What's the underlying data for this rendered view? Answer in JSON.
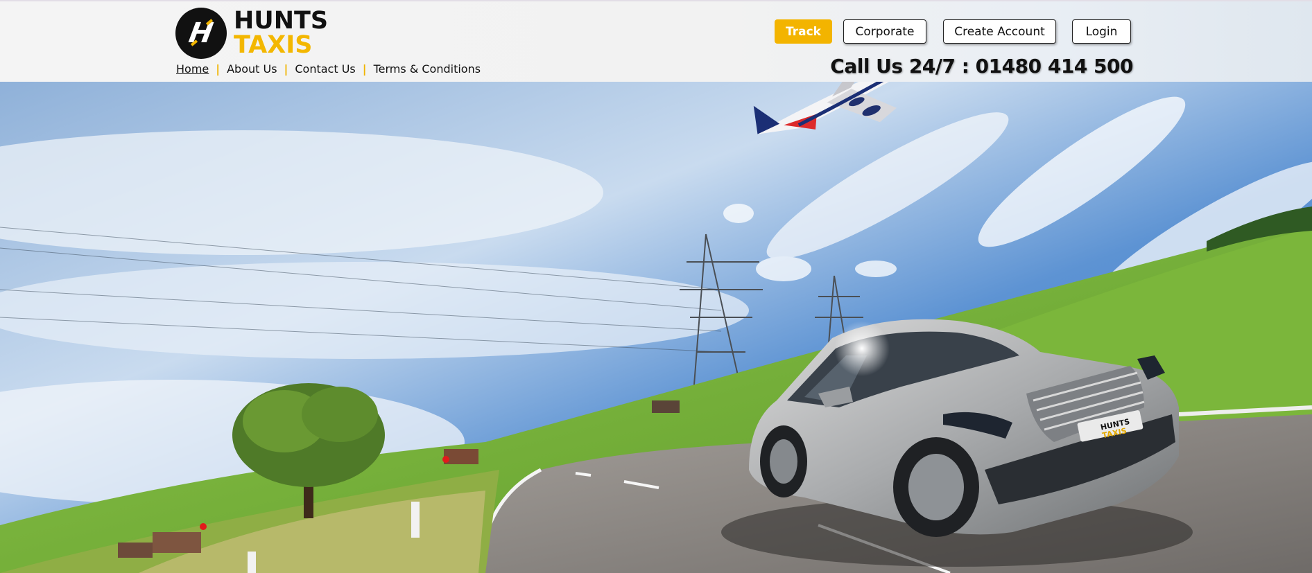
{
  "brand": {
    "logo_letter": "H",
    "name_top": "HUNTS",
    "name_bottom": "TAXIS",
    "accent_color": "#f3b400"
  },
  "nav": {
    "items": [
      {
        "label": "Home",
        "active": true
      },
      {
        "label": "About Us",
        "active": false
      },
      {
        "label": "Contact Us",
        "active": false
      },
      {
        "label": "Terms & Conditions",
        "active": false
      }
    ]
  },
  "actions": {
    "track": "Track",
    "corporate": "Corporate",
    "create_account": "Create Account",
    "login": "Login"
  },
  "callus": "Call Us 24/7 : 01480 414 500",
  "hero": {
    "plate_line1": "HUNTS",
    "plate_line2": "TAXIS"
  }
}
